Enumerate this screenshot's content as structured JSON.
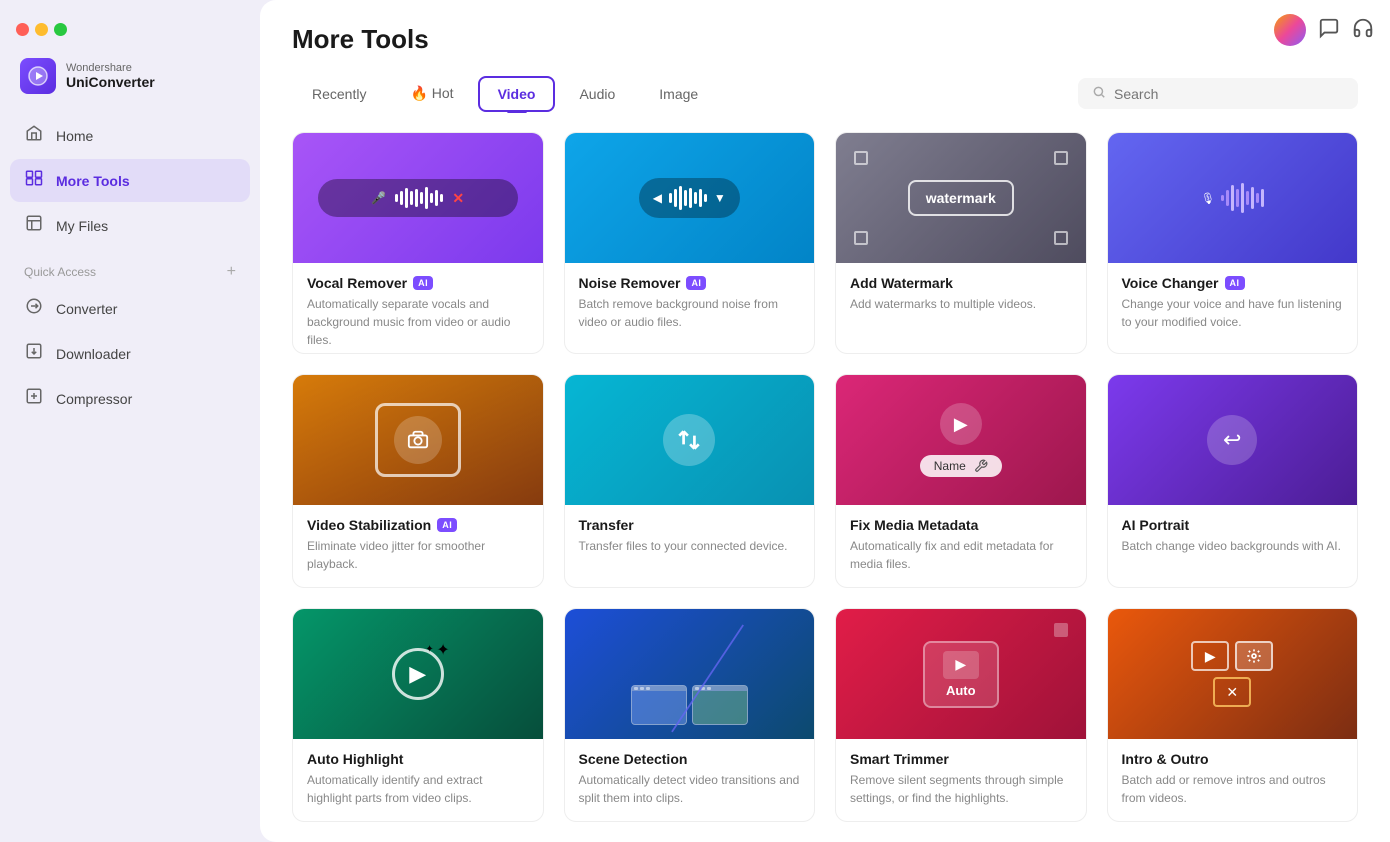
{
  "window": {
    "title": "Wondershare UniConverter"
  },
  "sidebar": {
    "logo_line1": "Wondershare",
    "logo_line2": "UniConverter",
    "nav_items": [
      {
        "id": "home",
        "label": "Home",
        "icon": "🏠",
        "active": false
      },
      {
        "id": "more-tools",
        "label": "More Tools",
        "icon": "🔧",
        "active": true
      },
      {
        "id": "my-files",
        "label": "My Files",
        "icon": "📄",
        "active": false
      }
    ],
    "quick_access_label": "Quick Access",
    "quick_access_items": [
      {
        "id": "converter",
        "label": "Converter",
        "icon": "🔄"
      },
      {
        "id": "downloader",
        "label": "Downloader",
        "icon": "📥"
      },
      {
        "id": "compressor",
        "label": "Compressor",
        "icon": "🗜️"
      }
    ]
  },
  "main": {
    "page_title": "More Tools",
    "tabs": [
      {
        "id": "recently",
        "label": "Recently",
        "active": false
      },
      {
        "id": "hot",
        "label": "🔥 Hot",
        "active": false
      },
      {
        "id": "video",
        "label": "Video",
        "active": true
      },
      {
        "id": "audio",
        "label": "Audio",
        "active": false
      },
      {
        "id": "image",
        "label": "Image",
        "active": false
      }
    ],
    "search_placeholder": "Search",
    "tools": [
      {
        "id": "vocal-remover",
        "name": "Vocal Remover",
        "ai": true,
        "desc": "Automatically separate vocals and background music from video or audio files.",
        "thumb_class": "thumb-vocal",
        "thumb_type": "waveform"
      },
      {
        "id": "noise-remover",
        "name": "Noise Remover",
        "ai": true,
        "desc": "Batch remove background noise from video or audio files.",
        "thumb_class": "thumb-noise",
        "thumb_type": "waveform-download"
      },
      {
        "id": "add-watermark",
        "name": "Add Watermark",
        "ai": false,
        "desc": "Add watermarks to multiple videos.",
        "thumb_class": "thumb-watermark",
        "thumb_type": "watermark"
      },
      {
        "id": "voice-changer",
        "name": "Voice Changer",
        "ai": true,
        "desc": "Change your voice and have fun listening to your modified voice.",
        "thumb_class": "thumb-voice",
        "thumb_type": "voice-wave"
      },
      {
        "id": "video-stabilization",
        "name": "Video Stabilization",
        "ai": true,
        "desc": "Eliminate video jitter for smoother playback.",
        "thumb_class": "thumb-stabilization",
        "thumb_type": "camera"
      },
      {
        "id": "transfer",
        "name": "Transfer",
        "ai": false,
        "desc": "Transfer files to your connected device.",
        "thumb_class": "thumb-transfer",
        "thumb_type": "swap"
      },
      {
        "id": "fix-media-metadata",
        "name": "Fix Media Metadata",
        "ai": false,
        "desc": "Automatically fix and edit metadata for media files.",
        "thumb_class": "thumb-metadata",
        "thumb_type": "metadata"
      },
      {
        "id": "ai-portrait",
        "name": "AI Portrait",
        "ai": false,
        "desc": "Batch change video backgrounds with AI.",
        "thumb_class": "thumb-portrait",
        "thumb_type": "portrait"
      },
      {
        "id": "auto-highlight",
        "name": "Auto Highlight",
        "ai": false,
        "desc": "Automatically identify and extract highlight parts from video clips.",
        "thumb_class": "thumb-highlight",
        "thumb_type": "highlight"
      },
      {
        "id": "scene-detection",
        "name": "Scene Detection",
        "ai": false,
        "desc": "Automatically detect video transitions and split them into clips.",
        "thumb_class": "thumb-scene",
        "thumb_type": "scene"
      },
      {
        "id": "smart-trimmer",
        "name": "Smart Trimmer",
        "ai": false,
        "desc": "Remove silent segments through simple settings, or find the highlights.",
        "thumb_class": "thumb-trimmer",
        "thumb_type": "trimmer"
      },
      {
        "id": "intro-outro",
        "name": "Intro & Outro",
        "ai": false,
        "desc": "Batch add or remove intros and outros from videos.",
        "thumb_class": "thumb-intro",
        "thumb_type": "intro"
      }
    ]
  }
}
